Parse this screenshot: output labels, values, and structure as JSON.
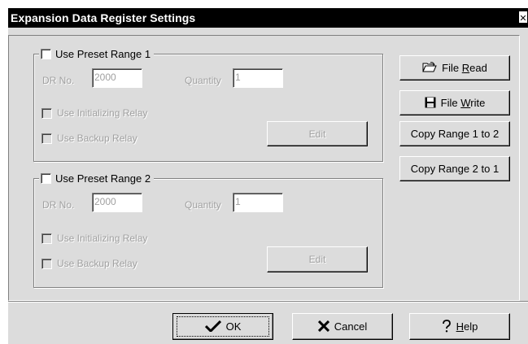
{
  "window": {
    "title": "Expansion Data Register Settings",
    "close_label": "✕"
  },
  "range1": {
    "legend": "Use Preset Range 1",
    "dr_label": "DR No.",
    "dr_value": "2000",
    "quantity_label": "Quantity",
    "quantity_value": "1",
    "init_relay_label": "Use Initializing Relay",
    "backup_relay_label": "Use Backup Relay",
    "edit_label": "Edit"
  },
  "range2": {
    "legend": "Use Preset Range 2",
    "dr_label": "DR No.",
    "dr_value": "2000",
    "quantity_label": "Quantity",
    "quantity_value": "1",
    "init_relay_label": "Use Initializing Relay",
    "backup_relay_label": "Use Backup Relay",
    "edit_label": "Edit"
  },
  "side_buttons": {
    "file_read_prefix": "File ",
    "file_read_underlined": "R",
    "file_read_suffix": "ead",
    "file_write_prefix": "File ",
    "file_write_underlined": "W",
    "file_write_suffix": "rite",
    "copy_1_to_2": "Copy Range 1 to 2",
    "copy_2_to_1": "Copy Range 2 to 1"
  },
  "footer": {
    "ok_label": "OK",
    "cancel_label": "Cancel",
    "help_underlined": "H",
    "help_suffix": "elp"
  },
  "icons": {
    "file_read": "folder-open-icon",
    "file_write": "floppy-disk-icon",
    "ok": "checkmark-icon",
    "cancel": "x-mark-icon",
    "help": "question-mark-icon"
  },
  "colors": {
    "titlebar_bg": "#000000",
    "dialog_bg": "#dcdcdc",
    "disabled_text": "#a0a0a0"
  }
}
